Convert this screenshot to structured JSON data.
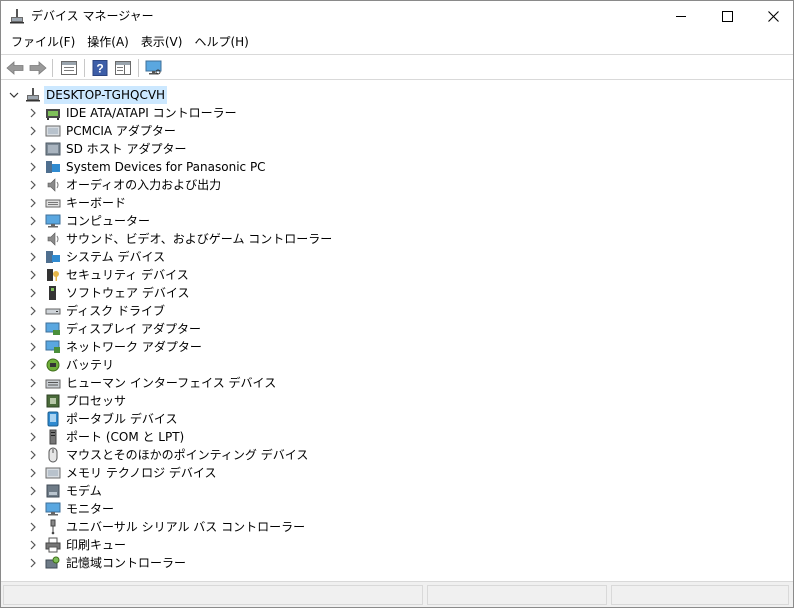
{
  "window": {
    "title": "デバイス マネージャー"
  },
  "menu": [
    {
      "label": "ファイル(F)"
    },
    {
      "label": "操作(A)"
    },
    {
      "label": "表示(V)"
    },
    {
      "label": "ヘルプ(H)"
    }
  ],
  "toolbar": {
    "icons": [
      "back-arrow-icon",
      "forward-arrow-icon",
      "properties-panel-icon",
      "help-icon",
      "action-pane-icon",
      "monitor-scan-icon"
    ]
  },
  "tree": {
    "root": {
      "label": "DESKTOP-TGHQCVH",
      "expanded": true
    },
    "nodes": [
      {
        "label": "IDE ATA/ATAPI コントローラー",
        "icon": "ide-controller-icon"
      },
      {
        "label": "PCMCIA アダプター",
        "icon": "pcmcia-icon"
      },
      {
        "label": "SD ホスト アダプター",
        "icon": "sd-host-icon"
      },
      {
        "label": "System Devices for Panasonic PC",
        "icon": "system-devices-icon"
      },
      {
        "label": "オーディオの入力および出力",
        "icon": "speaker-icon"
      },
      {
        "label": "キーボード",
        "icon": "keyboard-icon"
      },
      {
        "label": "コンピューター",
        "icon": "computer-icon"
      },
      {
        "label": "サウンド、ビデオ、およびゲーム コントローラー",
        "icon": "sound-icon"
      },
      {
        "label": "システム デバイス",
        "icon": "system-icon"
      },
      {
        "label": "セキュリティ デバイス",
        "icon": "security-key-icon"
      },
      {
        "label": "ソフトウェア デバイス",
        "icon": "software-device-icon"
      },
      {
        "label": "ディスク ドライブ",
        "icon": "disk-drive-icon"
      },
      {
        "label": "ディスプレイ アダプター",
        "icon": "display-adapter-icon"
      },
      {
        "label": "ネットワーク アダプター",
        "icon": "network-adapter-icon"
      },
      {
        "label": "バッテリ",
        "icon": "battery-icon"
      },
      {
        "label": "ヒューマン インターフェイス デバイス",
        "icon": "hid-icon"
      },
      {
        "label": "プロセッサ",
        "icon": "processor-icon"
      },
      {
        "label": "ポータブル デバイス",
        "icon": "portable-device-icon"
      },
      {
        "label": "ポート (COM と LPT)",
        "icon": "port-icon"
      },
      {
        "label": "マウスとそのほかのポインティング デバイス",
        "icon": "mouse-icon"
      },
      {
        "label": "メモリ テクノロジ デバイス",
        "icon": "memory-tech-icon"
      },
      {
        "label": "モデム",
        "icon": "modem-icon"
      },
      {
        "label": "モニター",
        "icon": "monitor-icon"
      },
      {
        "label": "ユニバーサル シリアル バス コントローラー",
        "icon": "usb-icon"
      },
      {
        "label": "印刷キュー",
        "icon": "printer-icon"
      },
      {
        "label": "記憶域コントローラー",
        "icon": "storage-controller-icon"
      }
    ]
  },
  "colors": {
    "selection": "#cce8ff",
    "accent": "#0078d7"
  }
}
